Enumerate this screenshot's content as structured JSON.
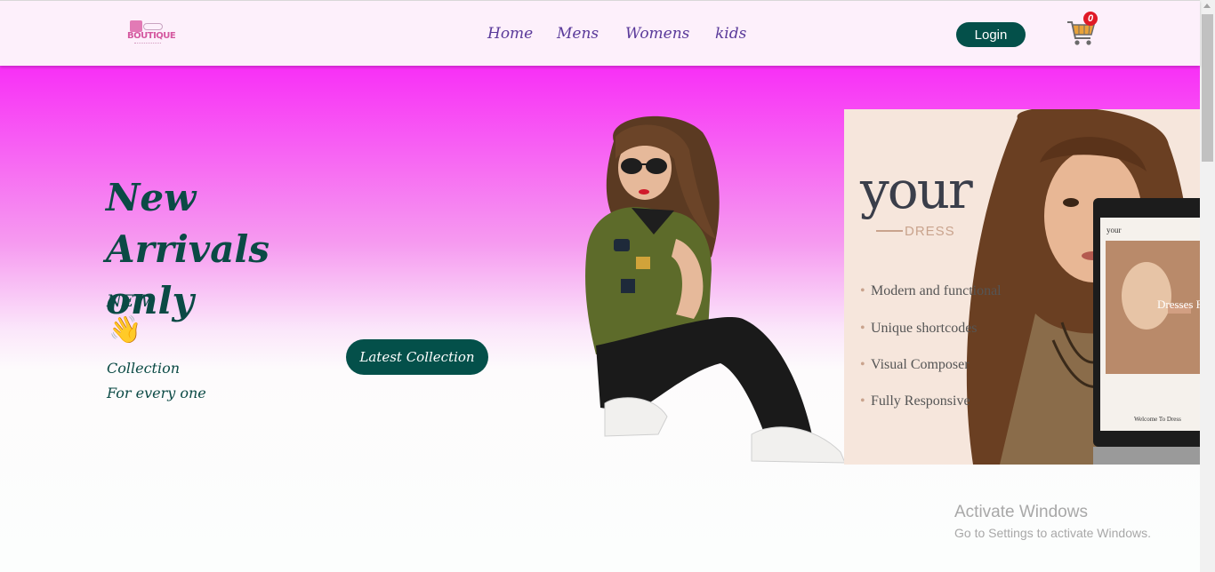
{
  "header": {
    "logo_text": "BOUTIQUE",
    "nav": [
      "Home",
      "Mens",
      "Womens",
      "kids"
    ],
    "login_label": "Login",
    "cart_count": "0"
  },
  "hero": {
    "title": "New Arrivals only",
    "new_label": "NEW",
    "wave_emoji": "👋",
    "collection_line1": "Collection",
    "collection_line2": "For every one",
    "button_label": "Latest Collection"
  },
  "banner": {
    "brand": "your",
    "brand_sub": "DRESS",
    "features": [
      "Modern and functional",
      "Unique shortcodes",
      "Visual Composer",
      "Fully Responsive"
    ],
    "laptop_logo": "your",
    "laptop_heading": "Dresses For",
    "laptop_welcome": "Welcome To Dress"
  },
  "watermark": {
    "title": "Activate Windows",
    "subtitle": "Go to Settings to activate Windows."
  },
  "colors": {
    "accent": "#04504a",
    "hero_top": "#f82ff6",
    "nav_text": "#5a3a9a"
  }
}
